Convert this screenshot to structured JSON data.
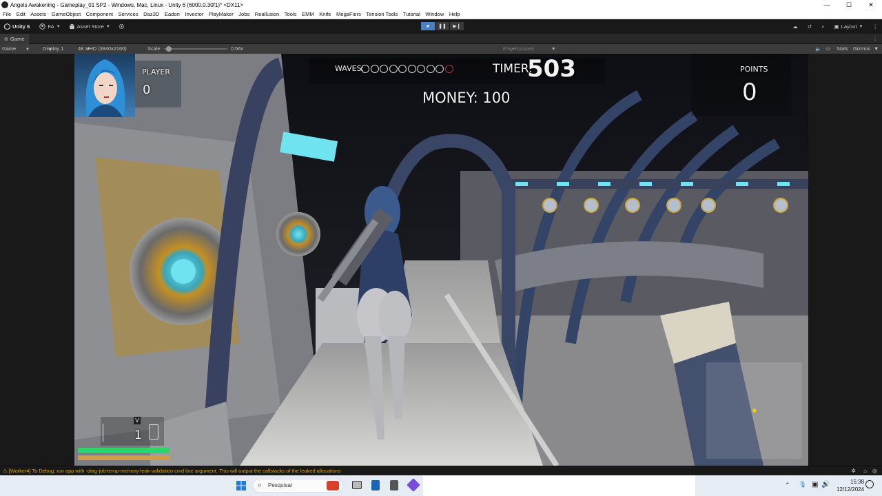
{
  "window": {
    "title": "Angels Awakening - Gameplay_01 SP2 - Windows, Mac, Linux - Unity 6 (6000.0.30f1)* <DX11>",
    "controls": [
      "—",
      "☐",
      "✕"
    ]
  },
  "menu": [
    "File",
    "Edit",
    "Assets",
    "GameObject",
    "Component",
    "Services",
    "Daz3D",
    "Eadon",
    "Invector",
    "PlayMaker",
    "Jobs",
    "Reallusion",
    "Tools",
    "EMM",
    "Knife",
    "MegaFiers",
    "Tension Tools",
    "Tutorial",
    "Window",
    "Help"
  ],
  "toolbar": {
    "unity_label": "Unity 6",
    "account_label": "FA",
    "asset_store_label": "Asset Store",
    "layout_label": "Layout"
  },
  "tab": {
    "label": "Game"
  },
  "gamebar": {
    "mode": "Game",
    "display": "Display 1",
    "resolution": "4K UHD (3840x2160)",
    "scale_label": "Scale",
    "scale_value": "0.56x",
    "scale_fraction": 0.04,
    "play_focused": "Play Focused",
    "stats": "Stats",
    "gizmos": "Gizmos"
  },
  "hud": {
    "player_label": "PLAYER",
    "player_score": "0",
    "waves_label": "WAVES:",
    "waves_total": 10,
    "waves_completed": 0,
    "timer_label": "TIMER:",
    "timer_value": "503",
    "money_text": "MONEY: 100",
    "points_label": "POINTS",
    "points_value": "0",
    "weapon_key": "V",
    "ammo": "1",
    "health_fraction": 1.0,
    "stamina_fraction": 1.0
  },
  "console": {
    "message": "[Worker4] To Debug, run app with -diag-job-temp-memory-leak-validation cmd line argument. This will output the callstacks of the leaked allocations"
  },
  "taskbar": {
    "search_placeholder": "Pesquisar",
    "time": "15:38",
    "date": "12/12/2024"
  },
  "colors": {
    "health": "#2ed46a",
    "stamina": "#d49a4a",
    "console_warning": "#d6a400",
    "play_active": "#4a7fc2",
    "wave_active_ring": "#b33a3a"
  }
}
